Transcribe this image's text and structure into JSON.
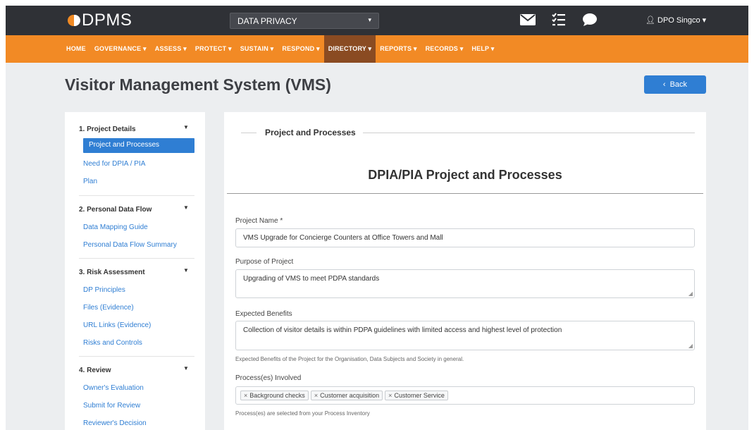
{
  "app": {
    "logo_text": "DPMS",
    "domain_select": "DATA PRIVACY",
    "user": "DPO Singco"
  },
  "colors": {
    "topbar": "#2f3136",
    "nav": "#f28a25",
    "nav_active": "#8a4b22",
    "primary": "#2f7ed3"
  },
  "nav": {
    "items": [
      {
        "label": "HOME"
      },
      {
        "label": "GOVERNANCE ▾"
      },
      {
        "label": "ASSESS ▾"
      },
      {
        "label": "PROTECT ▾"
      },
      {
        "label": "SUSTAIN ▾"
      },
      {
        "label": "RESPOND ▾"
      },
      {
        "label": "DIRECTORY ▾"
      },
      {
        "label": "REPORTS ▾"
      },
      {
        "label": "RECORDS ▾"
      },
      {
        "label": "HELP ▾"
      }
    ],
    "active_index": 6
  },
  "page": {
    "title": "Visitor Management System (VMS)",
    "back_label": "Back"
  },
  "sidebar": {
    "sections": [
      {
        "title": "1. Project Details",
        "items": [
          "Project and Processes",
          "Need for DPIA / PIA",
          "Plan"
        ]
      },
      {
        "title": "2. Personal Data Flow",
        "items": [
          "Data Mapping Guide",
          "Personal Data Flow Summary"
        ]
      },
      {
        "title": "3. Risk Assessment",
        "items": [
          "DP Principles",
          "Files (Evidence)",
          "URL Links (Evidence)",
          "Risks and Controls"
        ]
      },
      {
        "title": "4. Review",
        "items": [
          "Owner's Evaluation",
          "Submit for Review",
          "Reviewer's Decision"
        ]
      }
    ]
  },
  "form": {
    "legend": "Project and Processes",
    "heading": "DPIA/PIA Project and Processes",
    "project_name_label": "Project Name *",
    "project_name_value": "VMS Upgrade for Concierge Counters at Office Towers and Mall",
    "purpose_label": "Purpose of Project",
    "purpose_value": "Upgrading of VMS to meet PDPA standards",
    "benefits_label": "Expected Benefits",
    "benefits_value": "Collection of visitor details is within PDPA guidelines with limited access and highest level of protection",
    "benefits_help": "Expected Benefits of the Project for the Organisation, Data Subjects and Society in general.",
    "processes_label": "Process(es) Involved",
    "processes": [
      "Background checks",
      "Customer acquisition",
      "Customer Service"
    ],
    "processes_help": "Process(es) are selected from your Process Inventory"
  }
}
